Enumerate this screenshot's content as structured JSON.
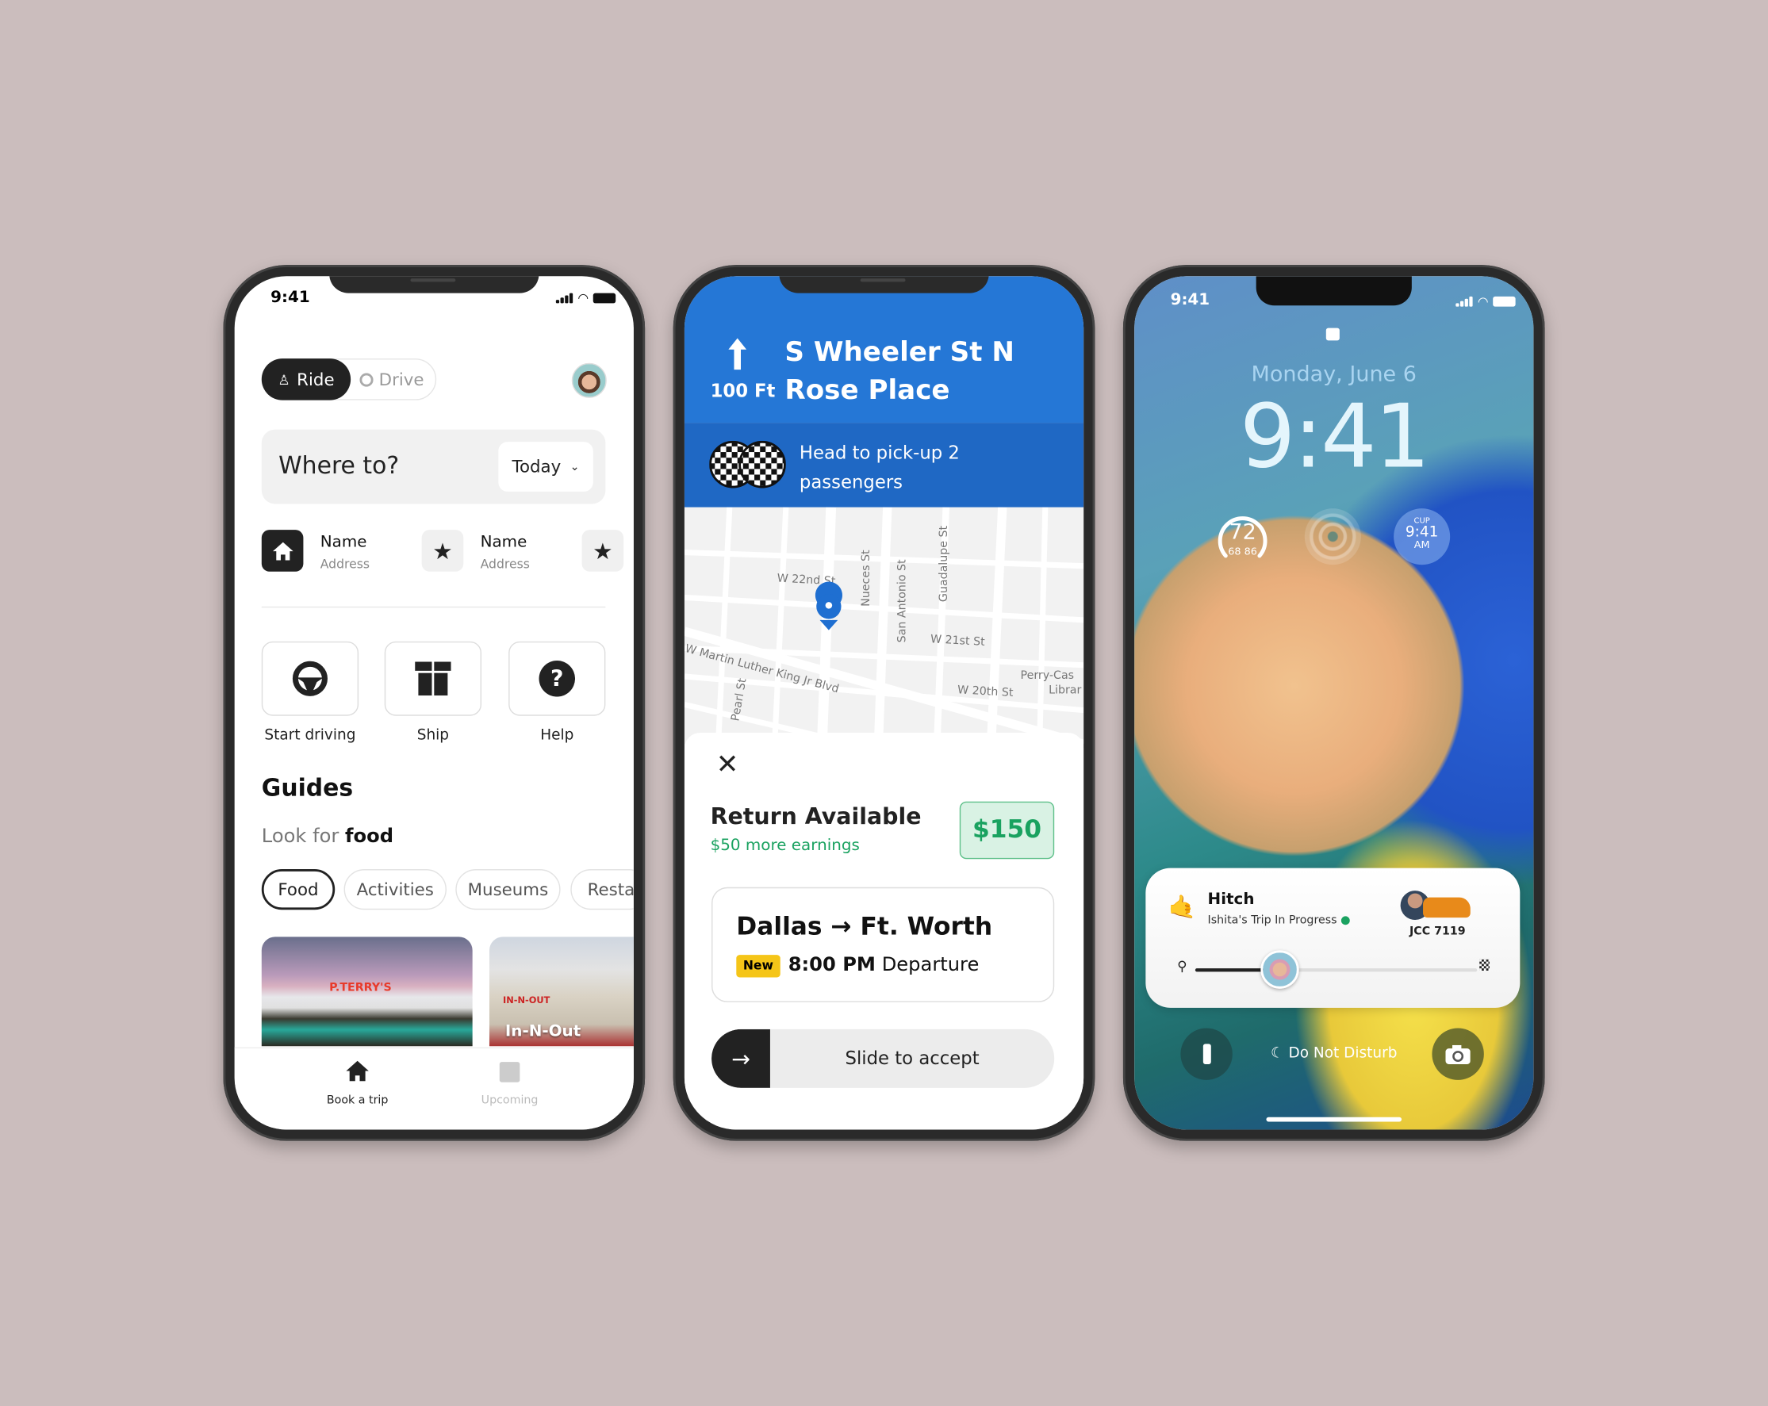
{
  "colors": {
    "background": "#cbbdbd",
    "nav_blue": "#2577d6",
    "earnings_green": "#1aa260",
    "new_badge": "#f5c518",
    "dark": "#222222"
  },
  "phone1": {
    "status_time": "9:41",
    "mode_toggle": {
      "ride": "Ride",
      "drive": "Drive",
      "selected": "Ride"
    },
    "search": {
      "placeholder": "Where to?",
      "when": "Today"
    },
    "saved_places": [
      {
        "icon": "home-icon",
        "name": "Name",
        "address": "Address"
      },
      {
        "icon": "star-icon",
        "name": "Name",
        "address": "Address"
      },
      {
        "icon": "star-icon"
      }
    ],
    "actions": [
      {
        "icon": "steering-wheel-icon",
        "label": "Start driving"
      },
      {
        "icon": "gift-box-icon",
        "label": "Ship"
      },
      {
        "icon": "help-icon",
        "label": "Help"
      }
    ],
    "guides_title": "Guides",
    "look_for_prefix": "Look for",
    "look_for_topic": "food",
    "chips": [
      "Food",
      "Activities",
      "Museums",
      "Resta"
    ],
    "selected_chip": "Food",
    "cards": [
      {
        "sign": "P.TERRY'S"
      },
      {
        "label": "In-N-Out",
        "sign": "IN-N-OUT"
      }
    ],
    "bottom_nav": [
      {
        "icon": "home-icon",
        "label": "Book a trip",
        "active": true
      },
      {
        "icon": "checklist-icon",
        "label": "Upcoming",
        "active": false
      }
    ]
  },
  "phone2": {
    "distance": "100 Ft",
    "street1": "S Wheeler St N",
    "street2": "Rose Place",
    "instruction_line1": "Head to pick-up 2",
    "instruction_line2": "passengers",
    "map_labels": {
      "w22": "W 22nd St",
      "nueces": "Nueces St",
      "san_antonio": "San Antonio St",
      "guadalupe": "Guadalupe St",
      "w21": "W 21st St",
      "mlk": "W Martin Luther King Jr Blvd",
      "pearl": "Pearl St",
      "w20": "W 20th St",
      "perry1": "Perry-Cas",
      "perry2": "Librar"
    },
    "offer_title": "Return Available",
    "offer_sub": "$50 more earnings",
    "price": "$150",
    "route": "Dallas → Ft. Worth",
    "badge": "New",
    "departure_time": "8:00 PM",
    "departure_label": "Departure",
    "slide_label": "Slide to accept"
  },
  "phone3": {
    "status_time": "9:41",
    "date": "Monday, June 6",
    "clock": "9:41",
    "weather": {
      "temp": "72",
      "low": "68",
      "high": "86"
    },
    "world_clock": {
      "city": "CUP",
      "time": "9:41",
      "ampm": "AM"
    },
    "live_activity": {
      "app": "Hitch",
      "status": "Ishita's Trip In Progress",
      "plate": "JCC 7119",
      "progress": 0.3
    },
    "focus": "Do Not Disturb"
  }
}
